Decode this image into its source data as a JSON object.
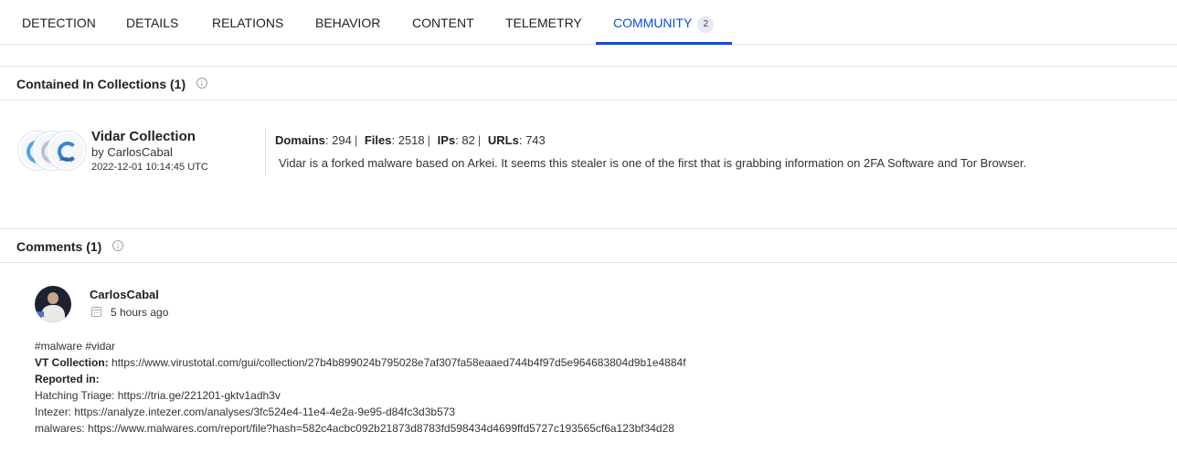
{
  "tabs": [
    {
      "label": "DETECTION"
    },
    {
      "label": "DETAILS"
    },
    {
      "label": "RELATIONS"
    },
    {
      "label": "BEHAVIOR"
    },
    {
      "label": "CONTENT"
    },
    {
      "label": "TELEMETRY"
    },
    {
      "label": "COMMUNITY",
      "badge": "2",
      "active": true
    }
  ],
  "accent_color": "#0b4dda",
  "collections": {
    "title": "Contained In Collections (1)",
    "info_icon": "info-icon",
    "item": {
      "icon_labels": [
        "setup"
      ],
      "name": "Vidar Collection",
      "author": "by CarlosCabal",
      "date": "2022-12-01 10:14:45 UTC",
      "stats": [
        {
          "label": "Domains",
          "value": "294"
        },
        {
          "label": "Files",
          "value": "2518"
        },
        {
          "label": "IPs",
          "value": "82"
        },
        {
          "label": "URLs",
          "value": "743"
        }
      ],
      "stats_separator": "|",
      "description": "Vidar is a forked malware based on Arkei. It seems this stealer is one of the first that is grabbing information on 2FA Software and Tor Browser."
    }
  },
  "comments": {
    "title": "Comments (1)",
    "info_icon": "info-icon",
    "item": {
      "author": "CarlosCabal",
      "time": "5 hours ago",
      "calendar_icon": "calendar-icon",
      "tags": "#malware #vidar",
      "vt_label": "VT Collection:",
      "vt_url": "https://www.virustotal.com/gui/collection/27b4b899024b795028e7af307fa58eaaed744b4f97d5e964683804d9b1e4884f",
      "reported_label": "Reported in:",
      "lines": [
        "Hatching Triage: https://tria.ge/221201-gktv1adh3v",
        "Intezer: https://analyze.intezer.com/analyses/3fc524e4-11e4-4e2a-9e95-d84fc3d3b573",
        "malwares: https://www.malwares.com/report/file?hash=582c4acbc092b21873d8783fd598434d4699ffd5727c193565cf6a123bf34d28"
      ]
    }
  }
}
